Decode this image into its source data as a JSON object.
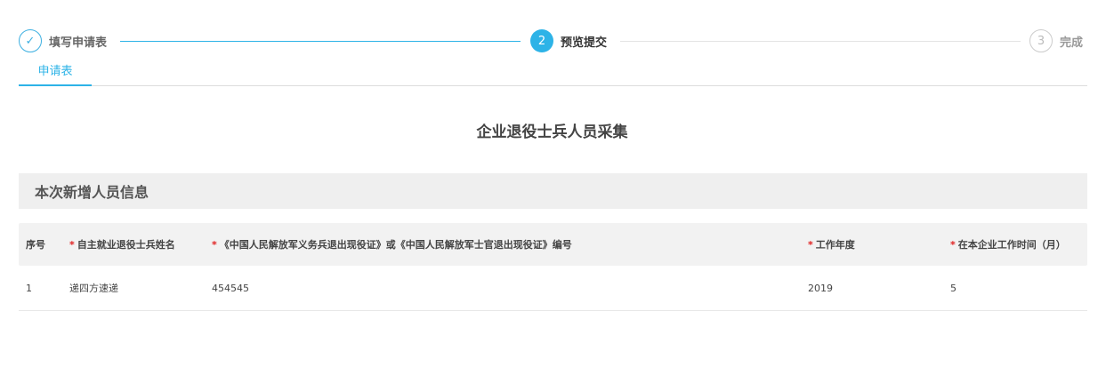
{
  "steps": [
    {
      "number": "✓",
      "label": "填写申请表"
    },
    {
      "number": "2",
      "label": "预览提交"
    },
    {
      "number": "3",
      "label": "完成"
    }
  ],
  "tabs": [
    {
      "label": "申请表"
    }
  ],
  "form": {
    "title": "企业退役士兵人员采集",
    "section_title": "本次新增人员信息"
  },
  "table": {
    "required_mark": "*",
    "headers": [
      "序号",
      "自主就业退役士兵姓名",
      "《中国人民解放军义务兵退出现役证》或《中国人民解放军士官退出现役证》编号",
      "工作年度",
      "在本企业工作时间（月）"
    ],
    "rows": [
      [
        "1",
        "递四方速递",
        "454545",
        "2019",
        "5"
      ]
    ]
  },
  "colors": {
    "accent": "#2db3e7",
    "required": "#e02020"
  }
}
